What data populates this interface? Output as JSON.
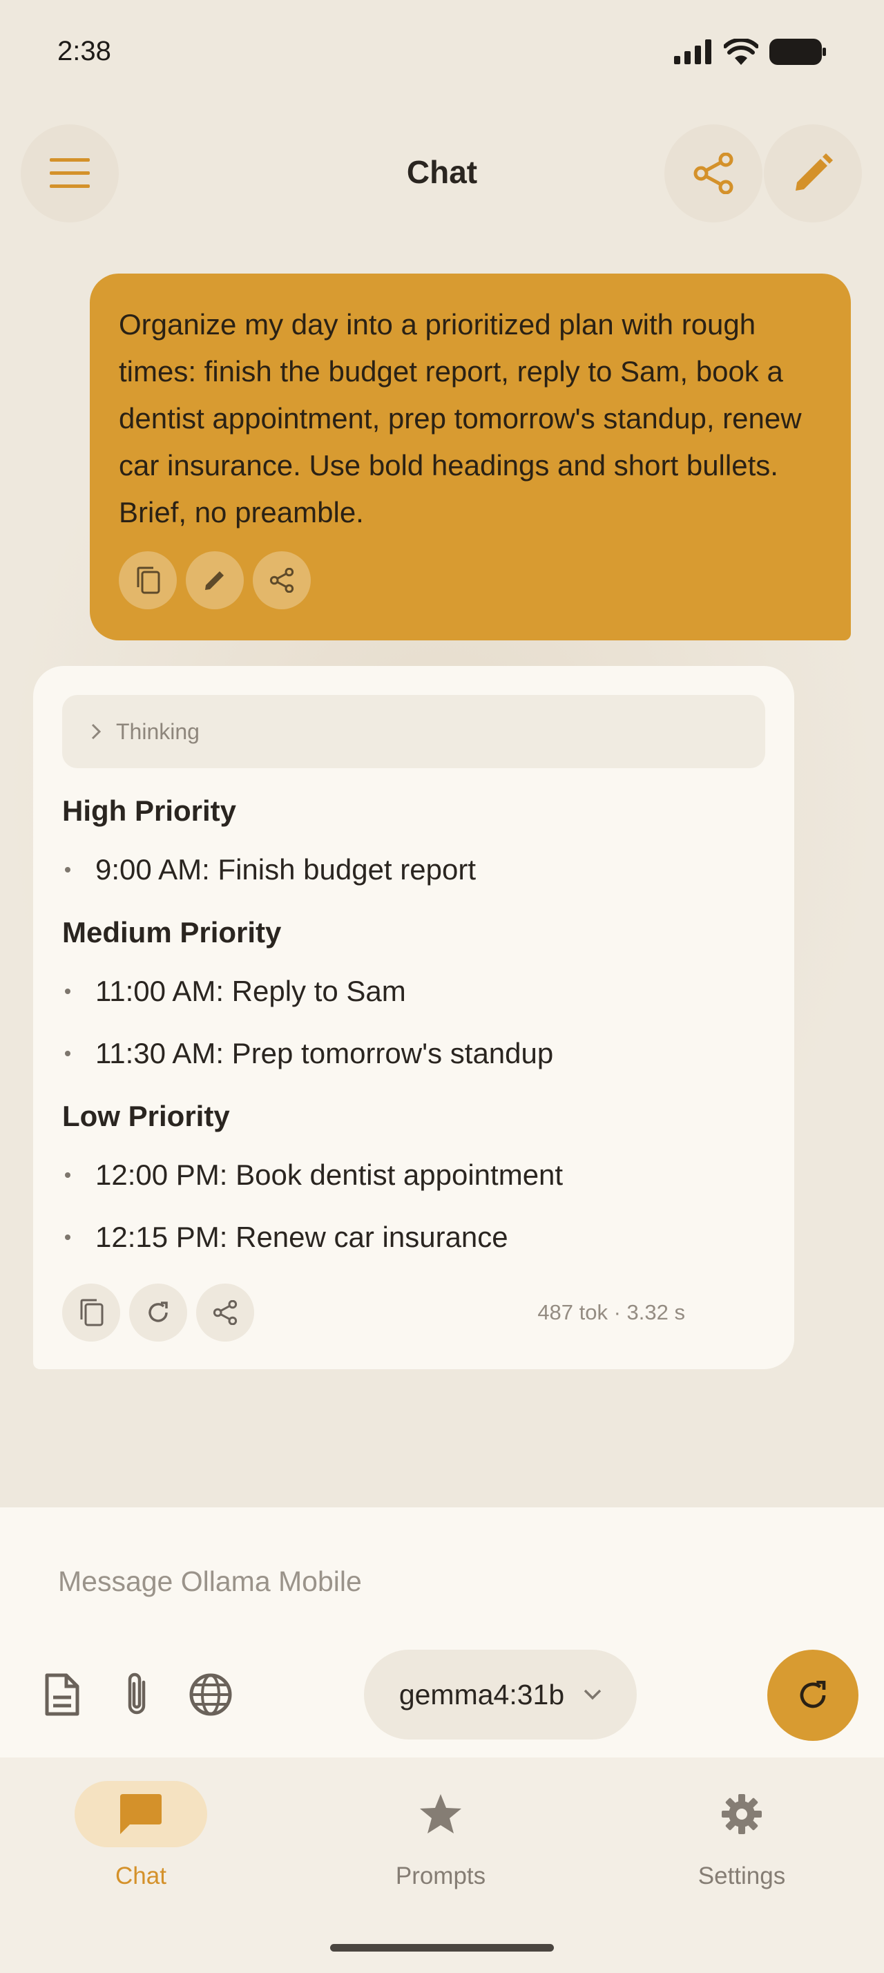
{
  "status_bar": {
    "time": "2:38"
  },
  "app_bar": {
    "title": "Chat"
  },
  "user_message": {
    "text": "Organize my day into a prioritized plan with rough times: finish the budget report, reply to Sam, book a dentist appointment, prep tomorrow's standup, renew car insurance. Use bold headings and short bullets. Brief, no preamble."
  },
  "assistant_message": {
    "thinking_label": "Thinking",
    "sections": [
      {
        "title": "High Priority",
        "items": [
          "9:00 AM: Finish budget report"
        ]
      },
      {
        "title": "Medium Priority",
        "items": [
          "11:00 AM: Reply to Sam",
          "11:30 AM: Prep tomorrow's standup"
        ]
      },
      {
        "title": "Low Priority",
        "items": [
          "12:00 PM: Book dentist appointment",
          "12:15 PM: Renew car insurance"
        ]
      }
    ],
    "meta": "487 tok · 3.32 s"
  },
  "composer": {
    "placeholder": "Message Ollama Mobile",
    "model": "gemma4:31b"
  },
  "bottom_nav": {
    "items": [
      {
        "label": "Chat",
        "icon": "chat-bubble-icon",
        "active": true
      },
      {
        "label": "Prompts",
        "icon": "star-icon",
        "active": false
      },
      {
        "label": "Settings",
        "icon": "gear-icon",
        "active": false
      }
    ]
  },
  "colors": {
    "accent": "#D89B31",
    "background": "#EEE8DD",
    "card": "#FBF8F2"
  }
}
